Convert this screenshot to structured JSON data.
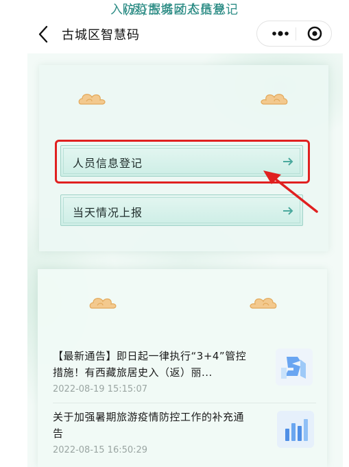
{
  "header": {
    "title": "古城区智慧码",
    "back_icon": "chevron-left-icon",
    "more_icon": "more-dots-icon",
    "target_icon": "target-circle-icon"
  },
  "registration": {
    "title": "入(返)古城区人员登记",
    "items": [
      {
        "label": "人员信息登记",
        "icon": "arrow-right-icon"
      },
      {
        "label": "当天情况上报",
        "icon": "arrow-right-icon"
      }
    ],
    "annotation_color": "#e02020"
  },
  "news_section": {
    "title": "防疫服务动态信息",
    "items": [
      {
        "headline": "【最新通告】即日起一律执行“3+4”管控措施！有西藏旅居史入（返）丽...",
        "date": "2022-08-19 15:15:07"
      },
      {
        "headline": "关于加强暑期旅游疫情防控工作的补充通告",
        "date": "2022-08-15 16:50:29"
      }
    ]
  },
  "colors": {
    "accent": "#2e8d86",
    "card_bg": "#ecf8f3",
    "date_gray": "#9aa5a2"
  }
}
